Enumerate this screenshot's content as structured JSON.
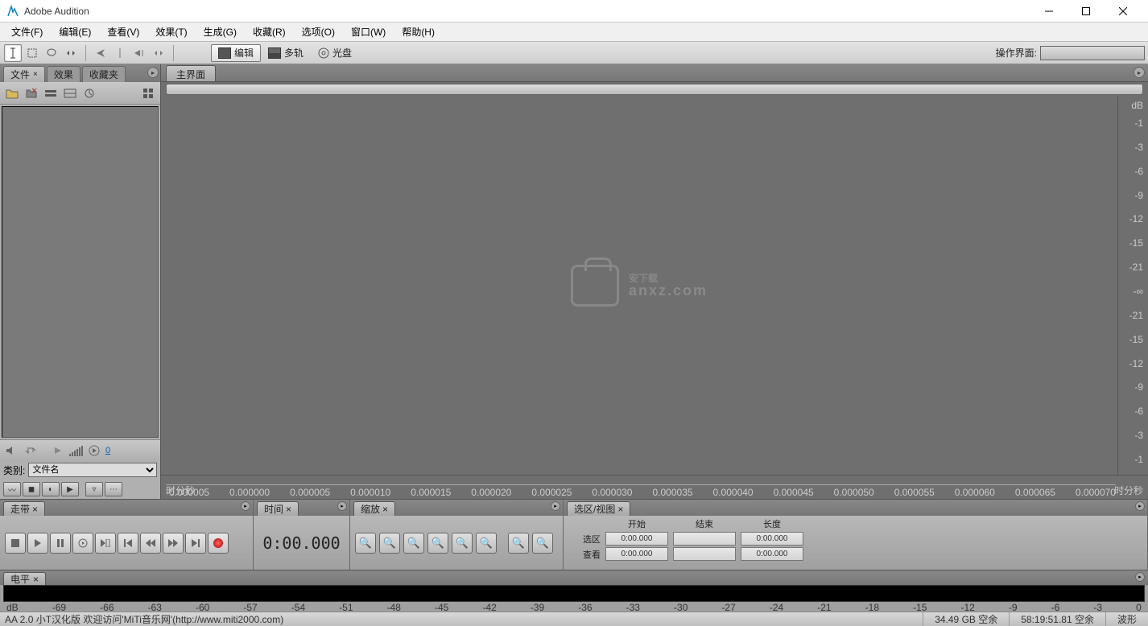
{
  "app": {
    "title": "Adobe Audition"
  },
  "menu": {
    "file": "文件(F)",
    "edit": "编辑(E)",
    "view": "查看(V)",
    "effects": "效果(T)",
    "generate": "生成(G)",
    "favorites": "收藏(R)",
    "options": "选项(O)",
    "window": "窗口(W)",
    "help": "帮助(H)"
  },
  "toolstrip": {
    "mode_edit": "编辑",
    "mode_multitrack": "多轨",
    "mode_cd": "光盘",
    "workspace_label": "操作界面:"
  },
  "left": {
    "tabs": {
      "files": "文件",
      "effects": "效果",
      "favorites": "收藏夹"
    },
    "category_label": "类别:",
    "category_value": "文件名",
    "volume_value": "0"
  },
  "main": {
    "tab": "主界面",
    "db_header": "dB",
    "db_ticks": [
      "-1",
      "-3",
      "-6",
      "-9",
      "-12",
      "-15",
      "-21",
      "-∞",
      "-21",
      "-15",
      "-12",
      "-9",
      "-6",
      "-3",
      "-1"
    ],
    "time_unit": "时分秒",
    "time_ticks": [
      "-0.000005",
      "0.000000",
      "0.000005",
      "0.000010",
      "0.000015",
      "0.000020",
      "0.000025",
      "0.000030",
      "0.000035",
      "0.000040",
      "0.000045",
      "0.000050",
      "0.000055",
      "0.000060",
      "0.000065",
      "0.000070"
    ],
    "watermark_main": "安下载",
    "watermark_sub": "anxz.com"
  },
  "transport": {
    "tab": "走带"
  },
  "time": {
    "tab": "时间",
    "value": "0:00.000"
  },
  "zoom": {
    "tab": "缩放"
  },
  "selection": {
    "tab": "选区/视图",
    "col_start": "开始",
    "col_end": "结束",
    "col_length": "长度",
    "row_sel": "选区",
    "row_view": "查看",
    "sel_start": "0:00.000",
    "sel_end": "",
    "sel_len": "0:00.000",
    "view_start": "0:00.000",
    "view_end": "",
    "view_len": "0:00.000"
  },
  "level": {
    "tab": "电平",
    "ticks": [
      "dB",
      "-69",
      "-66",
      "-63",
      "-60",
      "-57",
      "-54",
      "-51",
      "-48",
      "-45",
      "-42",
      "-39",
      "-36",
      "-33",
      "-30",
      "-27",
      "-24",
      "-21",
      "-18",
      "-15",
      "-12",
      "-9",
      "-6",
      "-3",
      "0"
    ]
  },
  "status": {
    "left": "AA 2.0 小T汉化版 欢迎访问'MiTi音乐网'(http://www.miti2000.com)",
    "disk": "34.49 GB 空余",
    "time_free": "58:19:51.81 空余",
    "mode": "波形"
  }
}
